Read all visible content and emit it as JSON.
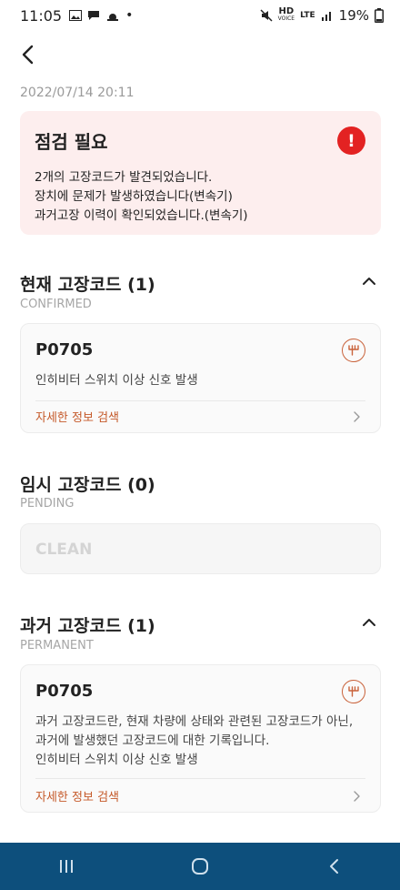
{
  "status_bar": {
    "time": "11:05",
    "battery": "19%",
    "network_hd": "HD",
    "network_voice": "VOICE",
    "network_lte": "LTE"
  },
  "timestamp": "2022/07/14 20:11",
  "alert": {
    "title": "점검 필요",
    "icon_symbol": "!",
    "lines": [
      "2개의 고장코드가 발견되었습니다.",
      "장치에 문제가 발생하였습니다(변속기)",
      "과거고장 이력이 확인되었습니다.(변속기)"
    ]
  },
  "sections": {
    "current": {
      "title": "현재 고장코드 (1)",
      "subtitle": "CONFIRMED",
      "code": "P0705",
      "description": "인히비터 스위치 이상 신호 발생",
      "link": "자세한 정보 검색"
    },
    "pending": {
      "title": "임시 고장코드 (0)",
      "subtitle": "PENDING",
      "status": "CLEAN"
    },
    "permanent": {
      "title": "과거 고장코드 (1)",
      "subtitle": "PERMANENT",
      "code": "P0705",
      "description_lines": [
        "과거 고장코드란, 현재 차량에 상태와 관련된 고장코드가 아닌,",
        "과거에 발생했던 고장코드에 대한 기록입니다.",
        "인히비터 스위치 이상 신호 발생"
      ],
      "link": "자세한 정보 검색"
    }
  },
  "colors": {
    "alert_bg": "#fdeeee",
    "alert_icon": "#e32222",
    "accent": "#c55a2a",
    "nav_bar": "#0d4f7c"
  },
  "icons": {
    "back": "chevron-left-icon",
    "collapse": "chevron-up-icon",
    "transmission": "gear-shift-icon",
    "link_arrow": "chevron-right-icon"
  }
}
